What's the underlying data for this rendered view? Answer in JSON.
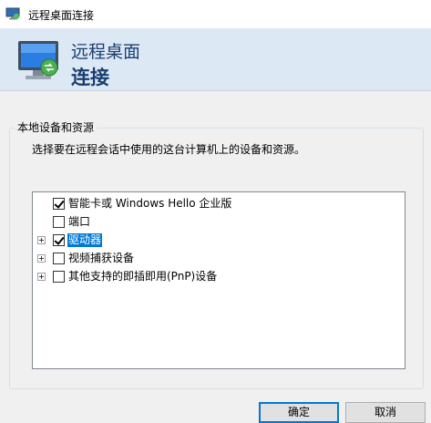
{
  "window": {
    "title": "远程桌面连接"
  },
  "banner": {
    "line1": "远程桌面",
    "line2": "连接"
  },
  "group": {
    "legend": "本地设备和资源",
    "description": "选择要在远程会话中使用的这台计算机上的设备和资源。"
  },
  "devices": [
    {
      "label": "智能卡或 Windows Hello 企业版",
      "checked": true,
      "expandable": false,
      "selected": false
    },
    {
      "label": "端口",
      "checked": false,
      "expandable": false,
      "selected": false
    },
    {
      "label": "驱动器",
      "checked": true,
      "expandable": true,
      "selected": true
    },
    {
      "label": "视频捕获设备",
      "checked": false,
      "expandable": true,
      "selected": false
    },
    {
      "label": "其他支持的即插即用(PnP)设备",
      "checked": false,
      "expandable": true,
      "selected": false
    }
  ],
  "buttons": {
    "ok": "确定",
    "cancel": "取消"
  },
  "colors": {
    "banner_bg": "#dde8f5",
    "banner_text": "#1a3f6f",
    "selection": "#0078d7"
  }
}
